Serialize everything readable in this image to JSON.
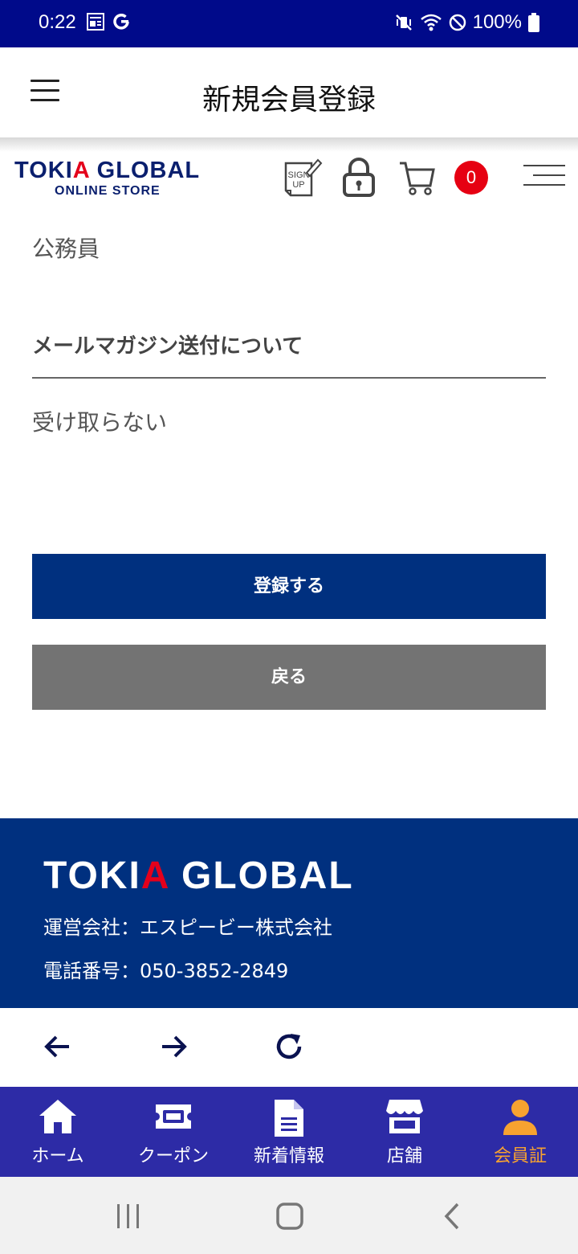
{
  "status_bar": {
    "time": "0:22",
    "battery": "100%"
  },
  "app_header": {
    "title": "新規会員登録"
  },
  "store": {
    "logo_line1_a": "TOKI",
    "logo_line1_b": "A",
    "logo_line1_c": " GLOBAL",
    "logo_line2": "ONLINE STORE",
    "cart_count": "0",
    "sign_up_icon_text": "SIGN UP"
  },
  "form": {
    "occupation_value": "公務員",
    "newsletter_label": "メールマガジン送付について",
    "newsletter_value": "受け取らない",
    "submit_label": "登録する",
    "back_label": "戻る"
  },
  "footer": {
    "logo_a": "TOKI",
    "logo_b": "A",
    "logo_c": " GLOBAL",
    "company": "運営会社：エスピービー株式会社",
    "phone": "電話番号：050-3852-2849"
  },
  "tabs": [
    {
      "label": "ホーム",
      "icon": "home-icon"
    },
    {
      "label": "クーポン",
      "icon": "ticket-icon"
    },
    {
      "label": "新着情報",
      "icon": "document-icon"
    },
    {
      "label": "店舗",
      "icon": "store-icon"
    },
    {
      "label": "会員証",
      "icon": "person-icon",
      "active": true
    }
  ],
  "colors": {
    "status_bar": "#000a8a",
    "primary": "#00307f",
    "tabbar": "#2d2ba6",
    "accent": "#f7a230",
    "badge": "#e60012"
  }
}
